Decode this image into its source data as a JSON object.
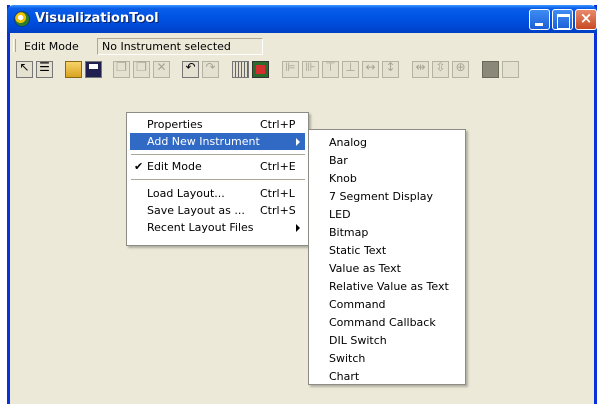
{
  "window": {
    "title": "VisualizationTool"
  },
  "status": {
    "mode": "Edit Mode",
    "instrument": "No Instrument selected"
  },
  "context_menu": {
    "properties": {
      "label": "Properties",
      "shortcut": "Ctrl+P"
    },
    "add_new_instrument": {
      "label": "Add New Instrument"
    },
    "edit_mode": {
      "label": "Edit Mode",
      "shortcut": "Ctrl+E",
      "checked": true
    },
    "load_layout": {
      "label": "Load Layout...",
      "shortcut": "Ctrl+L"
    },
    "save_layout": {
      "label": "Save Layout as ...",
      "shortcut": "Ctrl+S"
    },
    "recent_layouts": {
      "label": "Recent Layout Files"
    }
  },
  "submenu": {
    "items": [
      "Analog",
      "Bar",
      "Knob",
      "7 Segment Display",
      "LED",
      "Bitmap",
      "Static Text",
      "Value as Text",
      "Relative Value as Text",
      "Command",
      "Command Callback",
      "DIL Switch",
      "Switch",
      "Chart"
    ]
  },
  "colors": {
    "titlebar": "#0055e5",
    "highlight": "#316ac5",
    "chrome": "#ece9d8"
  }
}
